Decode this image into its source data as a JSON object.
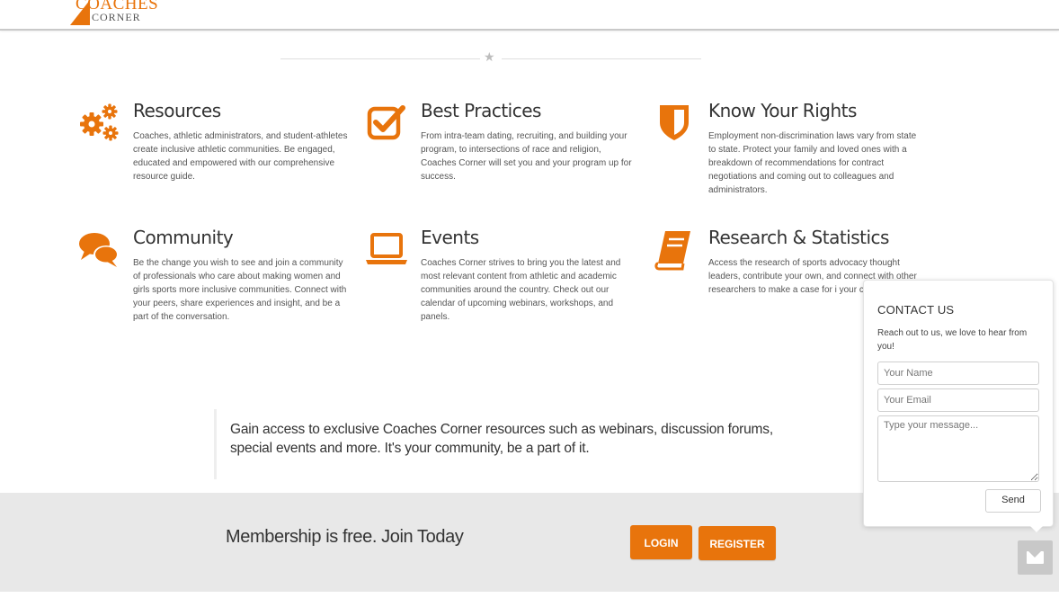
{
  "brand": {
    "name_line1": "COACHES",
    "name_line2": "CORNER",
    "accent": "#e8740c"
  },
  "divider": {
    "icon": "star-icon"
  },
  "features": [
    {
      "title": "Resources",
      "icon": "gears-icon",
      "text": "Coaches, athletic administrators, and student-athletes create inclusive athletic communities.  Be engaged, educated and empowered with our comprehensive resource guide."
    },
    {
      "title": "Best Practices",
      "icon": "checkbox-icon",
      "text": "From intra-team dating, recruiting, and building your program, to intersections of race and religion, Coaches Corner will set you and your program up for success."
    },
    {
      "title": "Know Your Rights",
      "icon": "shield-icon",
      "text": "Employment non-discrimination laws vary from state to state. Protect your family and loved ones with a breakdown of recommendations for contract negotiations and coming out to colleagues and administrators."
    },
    {
      "title": "Community",
      "icon": "chat-bubbles-icon",
      "text": "Be the change you wish to see and join a community of professionals who care about making women and girls sports more inclusive communities. Connect with your peers, share experiences and insight, and be a part of the conversation."
    },
    {
      "title": "Events",
      "icon": "laptop-icon",
      "text": "Coaches Corner strives to bring you the latest and most relevant content from athletic and academic communities around the country. Check out our calendar of upcoming webinars, workshops, and panels."
    },
    {
      "title": "Research & Statistics",
      "icon": "book-icon",
      "text": "Access the research of sports advocacy thought leaders, contribute your own, and connect with other researchers to make a case for i your campus."
    }
  ],
  "quote": {
    "line1": "Gain access to exclusive Coaches Corner resources such as webinars, discussion forums,",
    "line2": "special events and more. It's your community, be a part of it."
  },
  "membership": {
    "tagline": "Membership is free. Join Today",
    "login_label": "LOGIN",
    "register_label": "REGISTER"
  },
  "contact": {
    "title": "CONTACT US",
    "intro": "Reach out to us, we love to hear from you!",
    "name_placeholder": "Your Name",
    "email_placeholder": "Your Email",
    "message_placeholder": "Type your message...",
    "send_label": "Send",
    "tab_icon": "envelope-icon"
  }
}
